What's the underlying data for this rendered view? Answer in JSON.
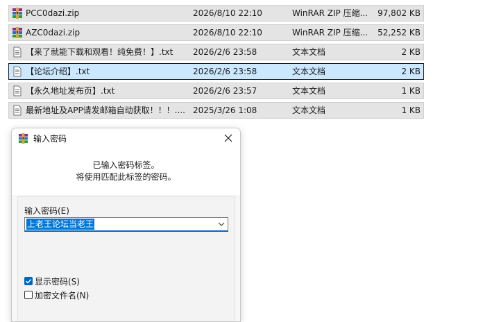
{
  "files": [
    {
      "name": "PCC0dazi.zip",
      "date": "2026/8/10 22:10",
      "type": "WinRAR ZIP 压缩...",
      "size": "97,802 KB",
      "icon": "winrar-archive-icon",
      "selected": false
    },
    {
      "name": "AZC0dazi.zip",
      "date": "2026/8/10 22:10",
      "type": "WinRAR ZIP 压缩...",
      "size": "52,252 KB",
      "icon": "winrar-archive-icon",
      "selected": false
    },
    {
      "name": "【来了就能下载和观看！纯免费！】.txt",
      "date": "2026/2/6 23:58",
      "type": "文本文档",
      "size": "2 KB",
      "icon": "text-file-icon",
      "selected": false
    },
    {
      "name": "【论坛介绍】.txt",
      "date": "2026/2/6 23:58",
      "type": "文本文档",
      "size": "2 KB",
      "icon": "text-file-icon",
      "selected": true
    },
    {
      "name": "【永久地址发布页】.txt",
      "date": "2026/2/6 23:57",
      "type": "文本文档",
      "size": "1 KB",
      "icon": "text-file-icon",
      "selected": false
    },
    {
      "name": "最新地址及APP请发邮箱自动获取！！！....",
      "date": "2025/3/26 1:08",
      "type": "文本文档",
      "size": "1 KB",
      "icon": "text-file-icon",
      "selected": false
    }
  ],
  "dialog": {
    "title": "输入密码",
    "title_icon": "winrar-icon",
    "close_icon": "close-icon",
    "info_line1": "已输入密码标签。",
    "info_line2": "将使用匹配此标签的密码。",
    "password_label": "输入密码(E)",
    "password_value": "上老王论坛当老王",
    "dropdown_icon": "chevron-down-icon",
    "show_password_label": "显示密码(S)",
    "show_password_checked": true,
    "encrypt_filenames_label": "加密文件名(N)",
    "encrypt_filenames_checked": false
  },
  "colors": {
    "row_background": "#e4e4e4",
    "selected_row_background": "#cce8ff",
    "accent": "#0067c0",
    "selection_highlight": "#0078d7"
  }
}
